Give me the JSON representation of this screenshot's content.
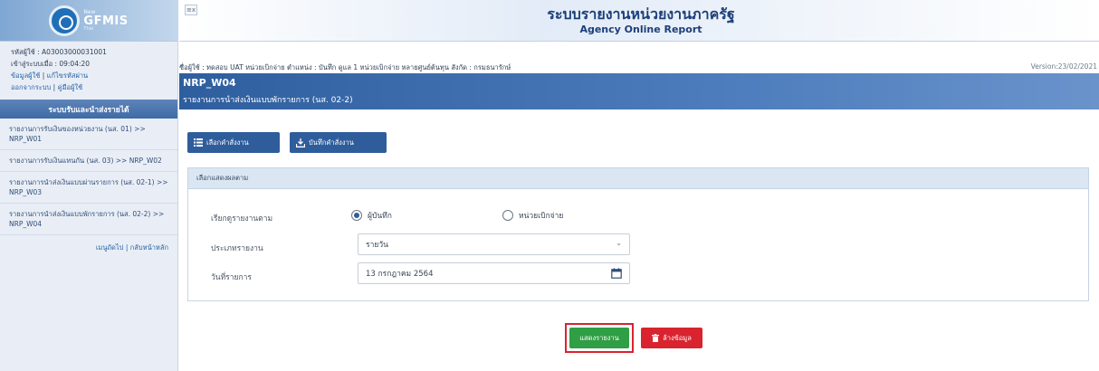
{
  "logo": {
    "new_label": "New",
    "name": "GFMIS",
    "sub": "Thai"
  },
  "sidebar": {
    "user_code": "รหัสผู้ใช้ : A03003000031001",
    "login_time": "เข้าสู่ระบบเมื่อ : 09:04:20",
    "profile_link": "ข้อมูลผู้ใช้",
    "password_link": "แก้ไขรหัสผ่าน",
    "logout_link": "ออกจากระบบ",
    "manual_link": "คู่มือผู้ใช้",
    "menu_header": "ระบบรับและนำส่งรายได้",
    "items": [
      {
        "label": "รายงานการรับเงินของหน่วยงาน (นส. 01) >> NRP_W01"
      },
      {
        "label": "รายงานการรับเงินแทนกัน (นส. 03) >> NRP_W02"
      },
      {
        "label": "รายงานการนำส่งเงินแบบผ่านรายการ (นส. 02-1) >> NRP_W03"
      },
      {
        "label": "รายงานการนำส่งเงินแบบพักรายการ (นส. 02-2) >> NRP_W04"
      }
    ],
    "footer_main": "เมนูถัดไป",
    "footer_back": "กลับหน้าหลัก"
  },
  "header": {
    "collapse_label": "≡x",
    "title": "ระบบรายงานหน่วยงานภาครัฐ",
    "subtitle": "Agency Online Report"
  },
  "user_bar": {
    "text": "ชื่อผู้ใช้ : ทดสอบ UAT หน่วยเบิกจ่าย   ตำแหน่ง : บันทึก ดูแล 1 หน่วยเบิกจ่าย หลายศูนย์ต้นทุน   สังกัด : กรมธนารักษ์",
    "version": "Version:23/02/2021"
  },
  "page": {
    "code": "NRP_W04",
    "title": "รายงานการนำส่งเงินแบบพักรายการ (นส. 02-2)"
  },
  "toolbar": {
    "select_cmd_label": "เลือกคำสั่งงาน",
    "save_cmd_label": "บันทึกคำสั่งงาน"
  },
  "form": {
    "panel_title": "เลือกแสดงผลตาม",
    "report_by_label": "เรียกดูรายงานตาม",
    "radio_recorder": "ผู้บันทึก",
    "radio_disburse": "หน่วยเบิกจ่าย",
    "report_type_label": "ประเภทรายงาน",
    "report_type_value": "รายวัน",
    "txn_date_label": "วันที่รายการ",
    "txn_date_value": "13 กรกฎาคม 2564"
  },
  "actions": {
    "show_report_label": "แสดงรายงาน",
    "clear_label": "ล้างข้อมูล"
  },
  "colors": {
    "primary": "#2f5d9c",
    "success": "#2f9e44",
    "danger": "#d9232e"
  }
}
